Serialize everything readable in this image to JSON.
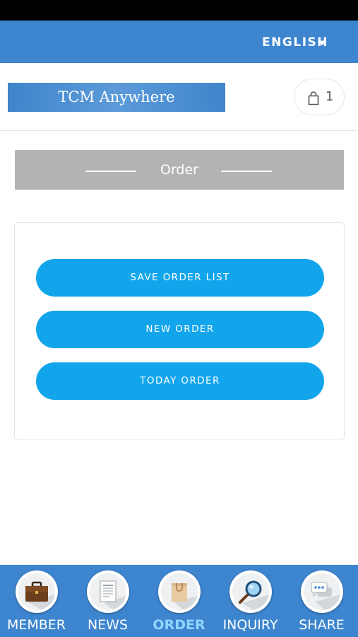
{
  "top_bar": {
    "language": "ENGLISH"
  },
  "header": {
    "logo_text": "TCM Anywhere",
    "cart_count": "1"
  },
  "section": {
    "title": "Order"
  },
  "buttons": {
    "save_order_list": "SAVE ORDER LIST",
    "new_order": "NEW ORDER",
    "today_order": "TODAY ORDER"
  },
  "nav": {
    "items": [
      {
        "label": "MEMBER",
        "icon": "briefcase-icon",
        "active": false
      },
      {
        "label": "NEWS",
        "icon": "newspaper-icon",
        "active": false
      },
      {
        "label": "ORDER",
        "icon": "shopping-bag-icon",
        "active": true
      },
      {
        "label": "INQUIRY",
        "icon": "magnifier-icon",
        "active": false
      },
      {
        "label": "SHARE",
        "icon": "chat-bubbles-icon",
        "active": false
      }
    ]
  },
  "colors": {
    "brand_blue": "#3d85cf",
    "button_blue": "#12a5ec",
    "title_bar_gray": "#b3b3b4",
    "active_nav": "#8fd6ff"
  }
}
